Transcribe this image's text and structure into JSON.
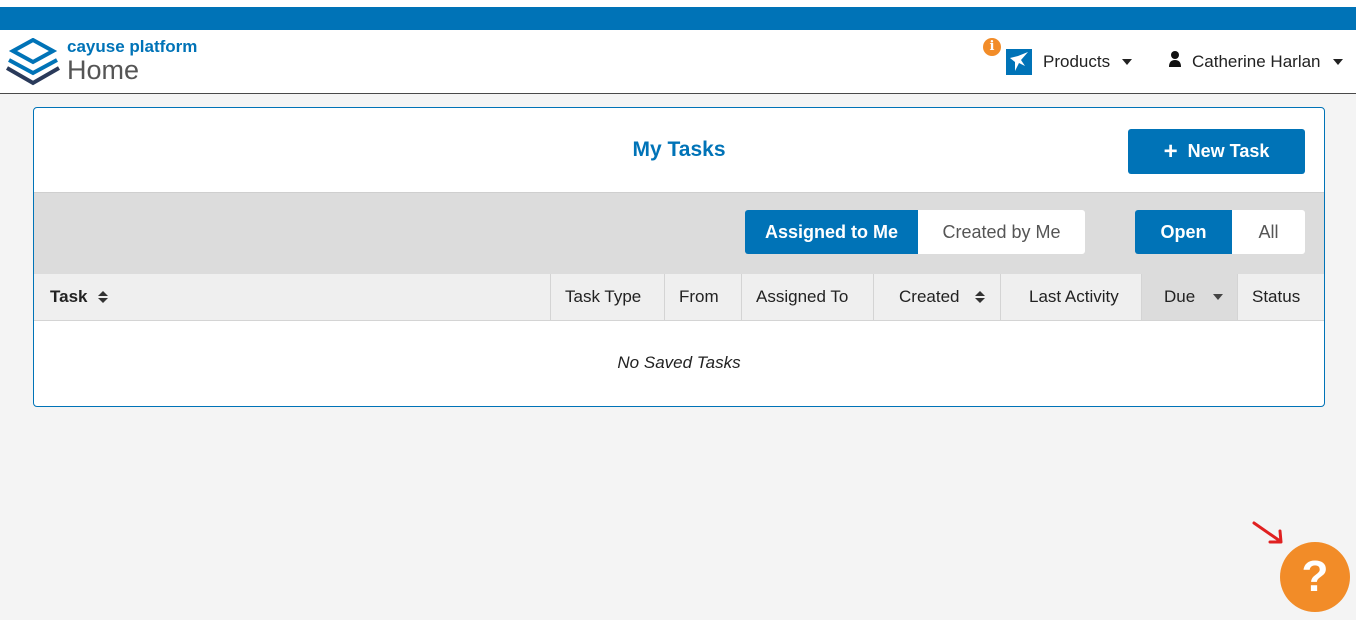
{
  "header": {
    "brand_name": "cayuse platform",
    "page_name": "Home",
    "info_icon_glyph": "i",
    "products_label": "Products",
    "user_name": "Catherine Harlan"
  },
  "tasks": {
    "title": "My Tasks",
    "new_task_label": "New Task",
    "filters": {
      "assigned_to_me": "Assigned to Me",
      "created_by_me": "Created by Me",
      "open": "Open",
      "all": "All"
    },
    "columns": [
      "Task",
      "Task Type",
      "From",
      "Assigned To",
      "Created",
      "Last Activity",
      "Due",
      "Status"
    ],
    "empty_message": "No Saved Tasks"
  },
  "help": {
    "glyph": "?"
  },
  "colors": {
    "brand_blue": "#0073b7",
    "accent_orange": "#f28c28",
    "annotation_red": "#e02020"
  },
  "icons": [
    "cayuse-logo-icon",
    "info-icon",
    "products-app-icon",
    "user-icon",
    "chevron-down-icon",
    "plus-icon",
    "sort-icon",
    "sort-down-icon",
    "help-icon",
    "red-arrow-icon"
  ]
}
